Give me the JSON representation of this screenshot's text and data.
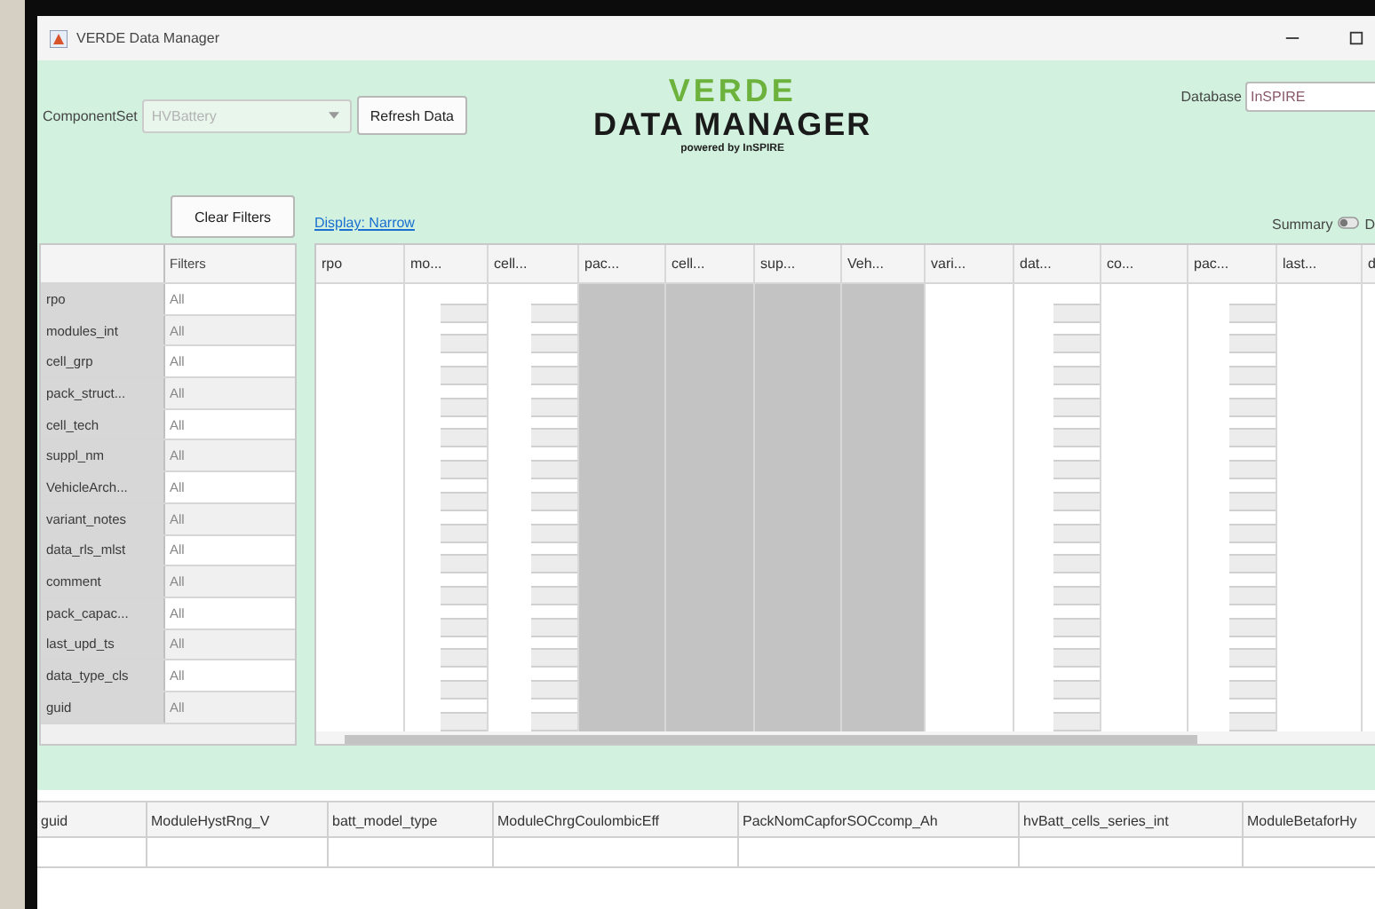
{
  "window": {
    "title": "VERDE Data Manager"
  },
  "component_set": {
    "label": "ComponentSet",
    "value": "HVBattery",
    "disabled": true
  },
  "refresh_button": "Refresh Data",
  "logo": {
    "top": "VERDE",
    "main": "DATA MANAGER",
    "sub": "powered by InSPIRE"
  },
  "database": {
    "label": "Database",
    "value": "InSPIRE"
  },
  "clear_filters_button": "Clear Filters",
  "display_link": "Display: Narrow",
  "summary": {
    "label": "Summary",
    "value": "D"
  },
  "filters": {
    "header": "Filters",
    "rows": [
      {
        "name": "rpo",
        "value": "All"
      },
      {
        "name": "modules_int",
        "value": "All"
      },
      {
        "name": "cell_grp",
        "value": "All"
      },
      {
        "name": "pack_struct...",
        "value": "All"
      },
      {
        "name": "cell_tech",
        "value": "All"
      },
      {
        "name": "suppl_nm",
        "value": "All"
      },
      {
        "name": "VehicleArch...",
        "value": "All"
      },
      {
        "name": "variant_notes",
        "value": "All"
      },
      {
        "name": "data_rls_mlst",
        "value": "All"
      },
      {
        "name": "comment",
        "value": "All"
      },
      {
        "name": "pack_capac...",
        "value": "All"
      },
      {
        "name": "last_upd_ts",
        "value": "All"
      },
      {
        "name": "data_type_cls",
        "value": "All"
      },
      {
        "name": "guid",
        "value": "All"
      }
    ]
  },
  "data_table": {
    "columns": [
      "rpo",
      "mo...",
      "cell...",
      "pac...",
      "cell...",
      "sup...",
      "Veh...",
      "vari...",
      "dat...",
      "co...",
      "pac...",
      "last...",
      "d"
    ]
  },
  "detail_table": {
    "columns": [
      "guid",
      "ModuleHystRng_V",
      "batt_model_type",
      "ModuleChrgCoulombicEff",
      "PackNomCapforSOCcomp_Ah",
      "hvBatt_cells_series_int",
      "ModuleBetaforHy"
    ]
  }
}
